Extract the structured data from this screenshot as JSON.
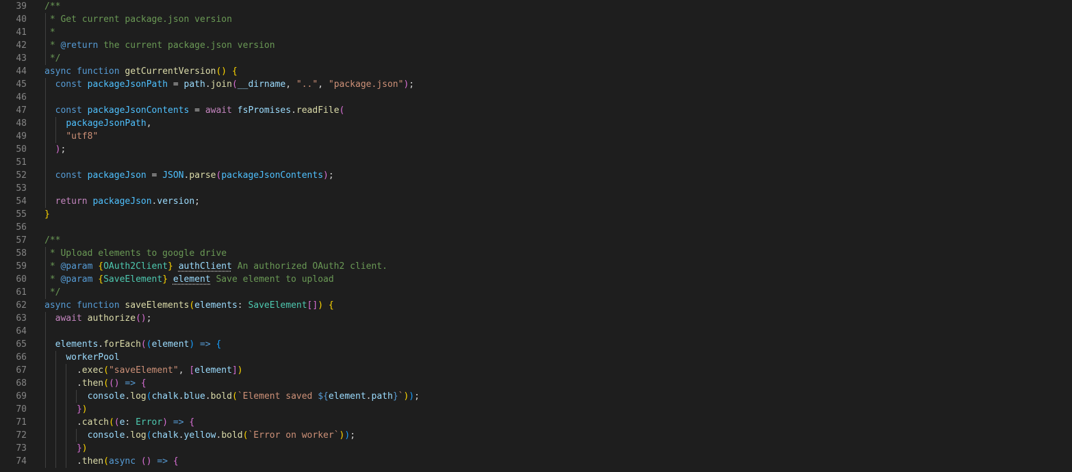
{
  "editor": {
    "language": "typescript",
    "colors": {
      "background": "#1e1e1e",
      "line_number": "#858585",
      "comment": "#6a9955",
      "keyword": "#569cd6",
      "control": "#c586c0",
      "function": "#dcdcaa",
      "variable": "#9cdcfe",
      "constant": "#4fc1ff",
      "string": "#ce9178",
      "type": "#4ec9b0",
      "text": "#d4d4d4",
      "bracket_level_1": "#ffd700",
      "bracket_level_2": "#da70d6",
      "bracket_level_3": "#179fff"
    },
    "lines": [
      {
        "n": "39",
        "tokens": [
          [
            "/**",
            "comment"
          ]
        ]
      },
      {
        "n": "40",
        "tokens": [
          [
            " * Get current package.json version",
            "comment"
          ]
        ]
      },
      {
        "n": "41",
        "tokens": [
          [
            " *",
            "comment"
          ]
        ]
      },
      {
        "n": "42",
        "tokens": [
          [
            " * ",
            "comment"
          ],
          [
            "@return",
            "doctag"
          ],
          [
            " the current package.json version",
            "comment"
          ]
        ]
      },
      {
        "n": "43",
        "tokens": [
          [
            " */",
            "comment"
          ]
        ]
      },
      {
        "n": "44",
        "tokens": [
          [
            "async",
            "keyword"
          ],
          [
            " ",
            "plain"
          ],
          [
            "function",
            "keyword"
          ],
          [
            " ",
            "plain"
          ],
          [
            "getCurrentVersion",
            "func"
          ],
          [
            "()",
            "b1"
          ],
          [
            " ",
            "plain"
          ],
          [
            "{",
            "b1"
          ]
        ]
      },
      {
        "n": "45",
        "tokens": [
          [
            "  ",
            "plain"
          ],
          [
            "const",
            "keyword"
          ],
          [
            " ",
            "plain"
          ],
          [
            "packageJsonPath",
            "const"
          ],
          [
            " = ",
            "plain"
          ],
          [
            "path",
            "var"
          ],
          [
            ".",
            "plain"
          ],
          [
            "join",
            "func"
          ],
          [
            "(",
            "b2"
          ],
          [
            "__dirname",
            "var"
          ],
          [
            ", ",
            "plain"
          ],
          [
            "\"..\"",
            "string"
          ],
          [
            ", ",
            "plain"
          ],
          [
            "\"package.json\"",
            "string"
          ],
          [
            ")",
            "b2"
          ],
          [
            ";",
            "plain"
          ]
        ]
      },
      {
        "n": "46",
        "tokens": []
      },
      {
        "n": "47",
        "tokens": [
          [
            "  ",
            "plain"
          ],
          [
            "const",
            "keyword"
          ],
          [
            " ",
            "plain"
          ],
          [
            "packageJsonContents",
            "const"
          ],
          [
            " = ",
            "plain"
          ],
          [
            "await",
            "control"
          ],
          [
            " ",
            "plain"
          ],
          [
            "fsPromises",
            "var"
          ],
          [
            ".",
            "plain"
          ],
          [
            "readFile",
            "func"
          ],
          [
            "(",
            "b2"
          ]
        ]
      },
      {
        "n": "48",
        "tokens": [
          [
            "    ",
            "plain"
          ],
          [
            "packageJsonPath",
            "const"
          ],
          [
            ",",
            "plain"
          ]
        ]
      },
      {
        "n": "49",
        "tokens": [
          [
            "    ",
            "plain"
          ],
          [
            "\"utf8\"",
            "string"
          ]
        ]
      },
      {
        "n": "50",
        "tokens": [
          [
            "  ",
            "plain"
          ],
          [
            ")",
            "b2"
          ],
          [
            ";",
            "plain"
          ]
        ]
      },
      {
        "n": "51",
        "tokens": []
      },
      {
        "n": "52",
        "tokens": [
          [
            "  ",
            "plain"
          ],
          [
            "const",
            "keyword"
          ],
          [
            " ",
            "plain"
          ],
          [
            "packageJson",
            "const"
          ],
          [
            " = ",
            "plain"
          ],
          [
            "JSON",
            "const"
          ],
          [
            ".",
            "plain"
          ],
          [
            "parse",
            "func"
          ],
          [
            "(",
            "b2"
          ],
          [
            "packageJsonContents",
            "const"
          ],
          [
            ")",
            "b2"
          ],
          [
            ";",
            "plain"
          ]
        ]
      },
      {
        "n": "53",
        "tokens": []
      },
      {
        "n": "54",
        "tokens": [
          [
            "  ",
            "plain"
          ],
          [
            "return",
            "control"
          ],
          [
            " ",
            "plain"
          ],
          [
            "packageJson",
            "const"
          ],
          [
            ".",
            "plain"
          ],
          [
            "version",
            "var"
          ],
          [
            ";",
            "plain"
          ]
        ]
      },
      {
        "n": "55",
        "tokens": [
          [
            "}",
            "b1"
          ]
        ]
      },
      {
        "n": "56",
        "tokens": []
      },
      {
        "n": "57",
        "tokens": [
          [
            "/**",
            "comment"
          ]
        ]
      },
      {
        "n": "58",
        "tokens": [
          [
            " * Upload elements to google drive",
            "comment"
          ]
        ]
      },
      {
        "n": "59",
        "tokens": [
          [
            " * ",
            "comment"
          ],
          [
            "@param",
            "doctag"
          ],
          [
            " ",
            "comment"
          ],
          [
            "{",
            "b1"
          ],
          [
            "OAuth2Client",
            "type"
          ],
          [
            "}",
            "b1"
          ],
          [
            " ",
            "comment"
          ],
          [
            "authClient",
            "var-dotted"
          ],
          [
            " An authorized OAuth2 client.",
            "comment"
          ]
        ]
      },
      {
        "n": "60",
        "tokens": [
          [
            " * ",
            "comment"
          ],
          [
            "@param",
            "doctag"
          ],
          [
            " ",
            "comment"
          ],
          [
            "{",
            "b1"
          ],
          [
            "SaveElement",
            "type"
          ],
          [
            "}",
            "b1"
          ],
          [
            " ",
            "comment"
          ],
          [
            "element",
            "var-dotted"
          ],
          [
            " Save element to upload",
            "comment"
          ]
        ]
      },
      {
        "n": "61",
        "tokens": [
          [
            " */",
            "comment"
          ]
        ]
      },
      {
        "n": "62",
        "tokens": [
          [
            "async",
            "keyword"
          ],
          [
            " ",
            "plain"
          ],
          [
            "function",
            "keyword"
          ],
          [
            " ",
            "plain"
          ],
          [
            "saveElements",
            "func"
          ],
          [
            "(",
            "b1"
          ],
          [
            "elements",
            "var"
          ],
          [
            ": ",
            "plain"
          ],
          [
            "SaveElement",
            "type"
          ],
          [
            "[]",
            "b2"
          ],
          [
            ")",
            "b1"
          ],
          [
            " ",
            "plain"
          ],
          [
            "{",
            "b1"
          ]
        ]
      },
      {
        "n": "63",
        "tokens": [
          [
            "  ",
            "plain"
          ],
          [
            "await",
            "control"
          ],
          [
            " ",
            "plain"
          ],
          [
            "authorize",
            "func"
          ],
          [
            "()",
            "b2"
          ],
          [
            ";",
            "plain"
          ]
        ]
      },
      {
        "n": "64",
        "tokens": []
      },
      {
        "n": "65",
        "tokens": [
          [
            "  ",
            "plain"
          ],
          [
            "elements",
            "var"
          ],
          [
            ".",
            "plain"
          ],
          [
            "forEach",
            "func"
          ],
          [
            "(",
            "b2"
          ],
          [
            "(",
            "b3"
          ],
          [
            "element",
            "var"
          ],
          [
            ")",
            "b3"
          ],
          [
            " ",
            "plain"
          ],
          [
            "=>",
            "keyword"
          ],
          [
            " ",
            "plain"
          ],
          [
            "{",
            "b3"
          ]
        ]
      },
      {
        "n": "66",
        "tokens": [
          [
            "    ",
            "plain"
          ],
          [
            "workerPool",
            "var"
          ]
        ]
      },
      {
        "n": "67",
        "tokens": [
          [
            "      .",
            "plain"
          ],
          [
            "exec",
            "func"
          ],
          [
            "(",
            "b1"
          ],
          [
            "\"saveElement\"",
            "string"
          ],
          [
            ", ",
            "plain"
          ],
          [
            "[",
            "b2"
          ],
          [
            "element",
            "var"
          ],
          [
            "]",
            "b2"
          ],
          [
            ")",
            "b1"
          ]
        ]
      },
      {
        "n": "68",
        "tokens": [
          [
            "      .",
            "plain"
          ],
          [
            "then",
            "func"
          ],
          [
            "(",
            "b1"
          ],
          [
            "()",
            "b2"
          ],
          [
            " ",
            "plain"
          ],
          [
            "=>",
            "keyword"
          ],
          [
            " ",
            "plain"
          ],
          [
            "{",
            "b2"
          ]
        ]
      },
      {
        "n": "69",
        "tokens": [
          [
            "        ",
            "plain"
          ],
          [
            "console",
            "var"
          ],
          [
            ".",
            "plain"
          ],
          [
            "log",
            "func"
          ],
          [
            "(",
            "b3"
          ],
          [
            "chalk",
            "var"
          ],
          [
            ".",
            "plain"
          ],
          [
            "blue",
            "var"
          ],
          [
            ".",
            "plain"
          ],
          [
            "bold",
            "func"
          ],
          [
            "(",
            "b1"
          ],
          [
            "`Element saved ",
            "string"
          ],
          [
            "${",
            "keyword"
          ],
          [
            "element",
            "var"
          ],
          [
            ".",
            "plain"
          ],
          [
            "path",
            "var"
          ],
          [
            "}",
            "keyword"
          ],
          [
            "`",
            "string"
          ],
          [
            ")",
            "b1"
          ],
          [
            ")",
            "b3"
          ],
          [
            ";",
            "plain"
          ]
        ]
      },
      {
        "n": "70",
        "tokens": [
          [
            "      ",
            "plain"
          ],
          [
            "}",
            "b2"
          ],
          [
            ")",
            "b1"
          ]
        ]
      },
      {
        "n": "71",
        "tokens": [
          [
            "      .",
            "plain"
          ],
          [
            "catch",
            "func"
          ],
          [
            "(",
            "b1"
          ],
          [
            "(",
            "b2"
          ],
          [
            "e",
            "var"
          ],
          [
            ": ",
            "plain"
          ],
          [
            "Error",
            "type"
          ],
          [
            ")",
            "b2"
          ],
          [
            " ",
            "plain"
          ],
          [
            "=>",
            "keyword"
          ],
          [
            " ",
            "plain"
          ],
          [
            "{",
            "b2"
          ]
        ]
      },
      {
        "n": "72",
        "tokens": [
          [
            "        ",
            "plain"
          ],
          [
            "console",
            "var"
          ],
          [
            ".",
            "plain"
          ],
          [
            "log",
            "func"
          ],
          [
            "(",
            "b3"
          ],
          [
            "chalk",
            "var"
          ],
          [
            ".",
            "plain"
          ],
          [
            "yellow",
            "var"
          ],
          [
            ".",
            "plain"
          ],
          [
            "bold",
            "func"
          ],
          [
            "(",
            "b1"
          ],
          [
            "`Error on worker`",
            "string"
          ],
          [
            ")",
            "b1"
          ],
          [
            ")",
            "b3"
          ],
          [
            ";",
            "plain"
          ]
        ]
      },
      {
        "n": "73",
        "tokens": [
          [
            "      ",
            "plain"
          ],
          [
            "}",
            "b2"
          ],
          [
            ")",
            "b1"
          ]
        ]
      },
      {
        "n": "74",
        "tokens": [
          [
            "      .",
            "plain"
          ],
          [
            "then",
            "func"
          ],
          [
            "(",
            "b1"
          ],
          [
            "async",
            "keyword"
          ],
          [
            " ",
            "plain"
          ],
          [
            "()",
            "b2"
          ],
          [
            " ",
            "plain"
          ],
          [
            "=>",
            "keyword"
          ],
          [
            " ",
            "plain"
          ],
          [
            "{",
            "b2"
          ]
        ]
      }
    ]
  }
}
